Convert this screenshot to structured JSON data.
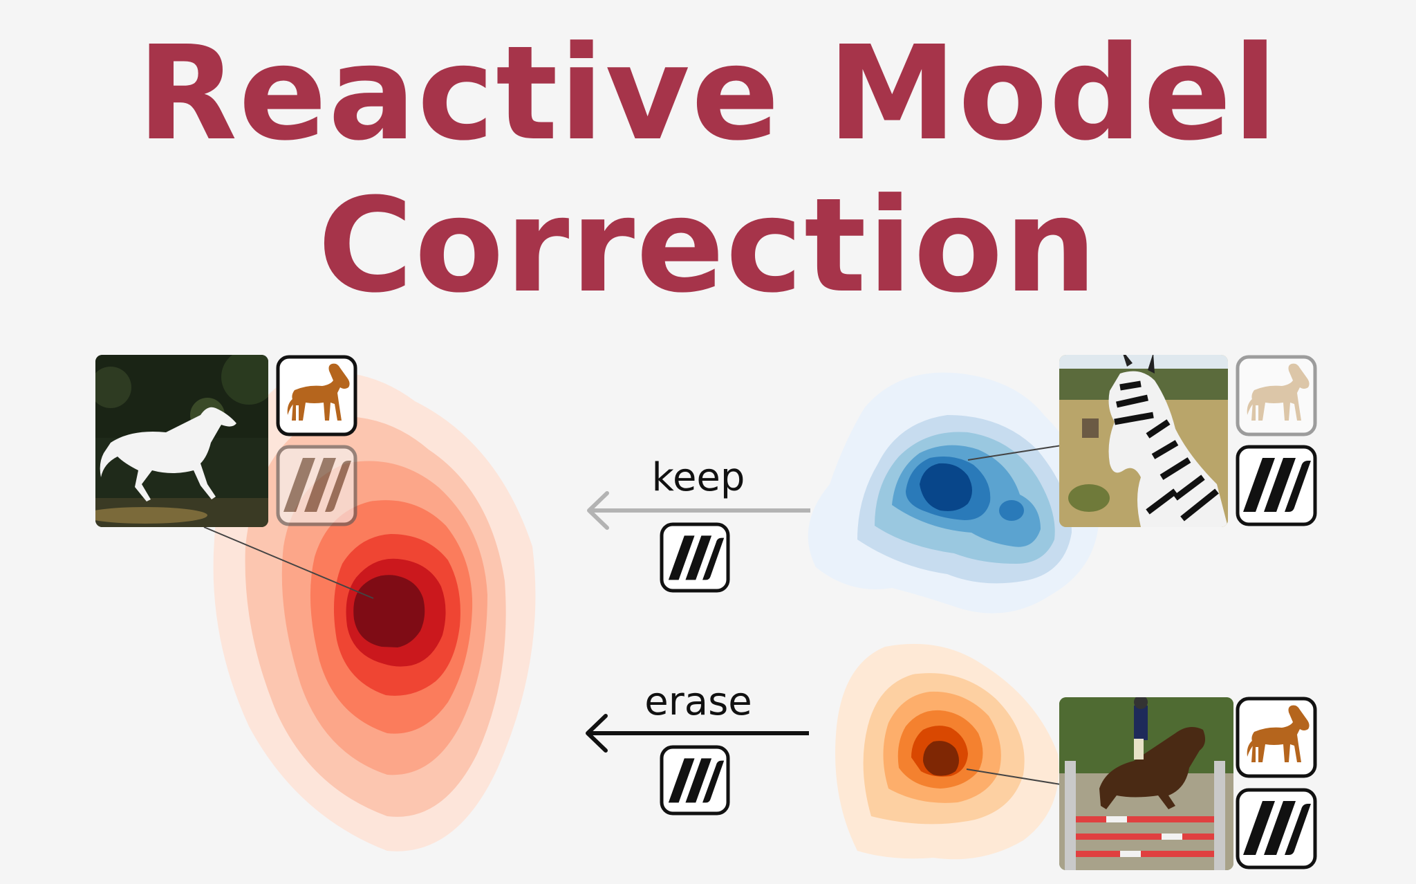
{
  "title": {
    "line1": "Reactive Model",
    "line2": "Correction"
  },
  "arrows": {
    "keep": {
      "label": "keep",
      "style": "grey"
    },
    "erase": {
      "label": "erase",
      "style": "black"
    }
  },
  "colors": {
    "title": "#a6344a",
    "red_density": "#7f0c15",
    "blue_density": "#08468a",
    "orange_density": "#7f2704",
    "keep_arrow": "#b3b3b3",
    "erase_arrow": "#111111",
    "horse_icon": "#b5651d"
  },
  "icons": [
    "horse-icon",
    "stripes-icon"
  ],
  "examples": [
    {
      "name": "white-horse-photo",
      "attributes": [
        "horse-icon",
        "stripes-icon-faded"
      ]
    },
    {
      "name": "zebra-photo",
      "attributes": [
        "horse-icon-faded",
        "stripes-icon"
      ]
    },
    {
      "name": "show-jumping-photo",
      "attributes": [
        "horse-icon",
        "stripes-icon"
      ]
    }
  ]
}
